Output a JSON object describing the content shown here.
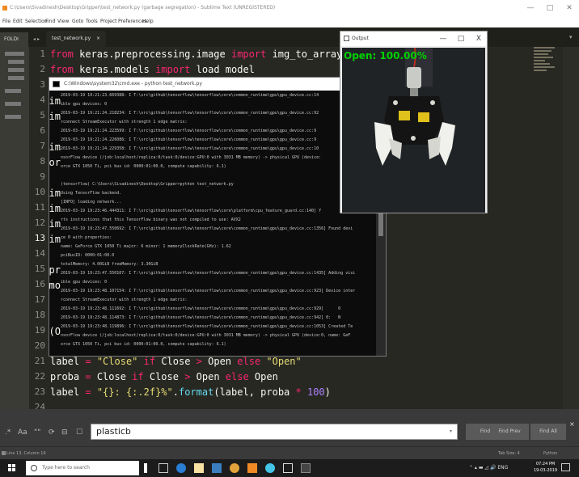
{
  "window": {
    "title": "C:\\Users\\Sivadinesh\\Desktop\\Gripper\\test_network.py (garbage segregation) - Sublime Text (UNREGISTERED)",
    "minimize": "—",
    "maximize": "□",
    "close": "✕"
  },
  "menu": [
    "File",
    "Edit",
    "Selection",
    "Find",
    "View",
    "Goto",
    "Tools",
    "Project",
    "Preferences",
    "Help"
  ],
  "sidebar": {
    "header": "FOLDI"
  },
  "tab": {
    "label": "test_network.py",
    "close": "×",
    "arrows": "◂ ▸"
  },
  "editor": {
    "current_line": "13",
    "line_numbers": [
      "1",
      "2",
      "3",
      "4",
      "5",
      "6",
      "7",
      "8",
      "9",
      "10",
      "11",
      "12",
      "13",
      "14",
      "15",
      "16",
      "17",
      "18",
      "19",
      "20",
      "21",
      "22",
      "23",
      "24",
      "25"
    ],
    "lines_visible": {
      "l1": "from keras.preprocessing.image import img_to_array",
      "l2": "from keras.models import load model",
      "l21": "label = \"Close\" if Close > Open else \"Open\"",
      "l22": "proba = Close if Close > Open else Open",
      "l23": "label = \"{}: {:.2f}%\".format(label, proba * 100)",
      "l25": "output = imutils.resize(orig, width=400)"
    },
    "edge_fragments": [
      "im",
      "im",
      "im",
      "",
      "im",
      "or",
      "",
      "im",
      "im",
      "im",
      "im",
      "",
      "pr",
      "mo",
      "",
      "",
      "(O",
      ""
    ]
  },
  "console": {
    "title": "C:\\Windows\\system32\\cmd.exe - python  test_network.py",
    "lines": [
      "2019-03-19 19:21:23.669388: I T:\\src\\github\\tensorflow\\tensorflow\\core\\common_runtime\\gpu\\gpu_device.cc:14",
      "ible gpu devices: 0",
      "2019-03-19 19:21:24.218234: I T:\\src\\github\\tensorflow\\tensorflow\\core\\common_runtime\\gpu\\gpu_device.cc:92",
      "rconnect StreamExecutor with strength 1 edge matrix:",
      "2019-03-19 19:21:24.223599: I T:\\src\\github\\tensorflow\\tensorflow\\core\\common_runtime\\gpu\\gpu_device.cc:9",
      "2019-03-19 19:21:24.226086: I T:\\src\\github\\tensorflow\\tensorflow\\core\\common_runtime\\gpu\\gpu_device.cc:9",
      "2019-03-19 19:21:24.229358: I T:\\src\\github\\tensorflow\\tensorflow\\core\\common_runtime\\gpu\\gpu_device.cc:10",
      "nsorFlow device (/job:localhost/replica:0/task:0/device:GPU:0 with 3031 MB memory) -> physical GPU (device:",
      "orce GTX 1050 Ti, pci bus id: 0000:01:00.0, compute capability: 6.1)",
      "",
      "(tensorflow) C:\\Users\\Sivadinesh\\Desktop\\Gripper>python test_network.py",
      "Using TensorFlow backend.",
      "[INFO] loading network...",
      "2019-03-19 19:23:46.444311: I T:\\src\\github\\tensorflow\\tensorflow\\core\\platform\\cpu_feature_guard.cc:140] Y",
      "rts instructions that this TensorFlow binary was not compiled to use: AVX2",
      "2019-03-19 19:23:47.550692: I T:\\src\\github\\tensorflow\\tensorflow\\core\\common_runtime\\gpu\\gpu_device.cc:1356] Found devi",
      "ce 0 with properties:",
      "name: GeForce GTX 1050 Ti major: 6 minor: 1 memoryClockRate(GHz): 1.62",
      "pciBusID: 0000:01:00.0",
      "totalMemory: 4.00GiB freeMemory: 3.30GiB",
      "2019-03-19 19:23:47.550107: I T:\\src\\github\\tensorflow\\tensorflow\\core\\common_runtime\\gpu\\gpu_device.cc:1435] Adding visi",
      "ible gpu devices: 0",
      "2019-03-19 19:23:48.107154: I T:\\src\\github\\tensorflow\\tensorflow\\core\\common_runtime\\gpu\\gpu_device.cc:923] Device inter",
      "rconnect StreamExecutor with strength 1 edge matrix:",
      "2019-03-19 19:23:48.111692: I T:\\src\\github\\tensorflow\\tensorflow\\core\\common_runtime\\gpu\\gpu_device.cc:929]      0",
      "2019-03-19 19:23:48.114873: I T:\\src\\github\\tensorflow\\tensorflow\\core\\common_runtime\\gpu\\gpu_device.cc:942] 0:   N",
      "2019-03-19 19:23:48.119896: I T:\\src\\github\\tensorflow\\tensorflow\\core\\common_runtime\\gpu\\gpu_device.cc:1053] Created Te",
      "nsorFlow device (/job:localhost/replica:0/task:0/device:GPU:0 with 3031 MB memory) -> physical GPU (device:0, name: GeF",
      "orce GTX 1050 Ti, pci bus id: 0000:01:00.0, compute capability: 6.1)"
    ]
  },
  "output": {
    "title": "Output",
    "label": "Open: 100.00%",
    "minimize": "—",
    "maximize": "□",
    "close": "X"
  },
  "find": {
    "options": [
      ".*",
      "Aa",
      "\"\"",
      "⟳",
      "⊟",
      "☐"
    ],
    "query": "plasticb",
    "dropdown": "▾",
    "buttons": [
      "Find",
      "Find Prev",
      "Find All"
    ],
    "close": "×"
  },
  "status": {
    "position": "Line 13, Column 16",
    "tab_size": "Tab Size: 4",
    "syntax": "Python"
  },
  "taskbar": {
    "search_placeholder": "Type here to search",
    "tray": "⌃  ▴  ▬  ◿  🔊  ENG",
    "time": "07:24 PM",
    "date": "19-03-2019"
  },
  "colors": {
    "editor_bg": "#272822",
    "keyword": "#f92672",
    "string": "#e6db74",
    "number": "#ae81ff",
    "func": "#66d9ef",
    "arg": "#fd971f",
    "output_label": "#00d000"
  }
}
